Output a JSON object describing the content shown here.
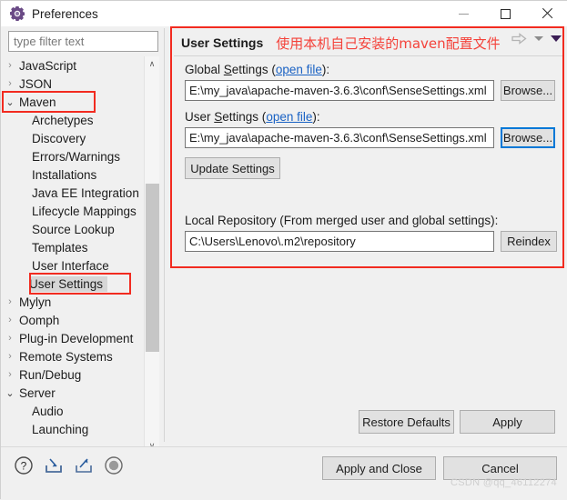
{
  "window": {
    "title": "Preferences",
    "icon": "gear-icon",
    "controls": {
      "minimize": "minimize-icon",
      "maximize": "maximize-icon",
      "close": "close-icon"
    }
  },
  "sidebar": {
    "filter": {
      "value": "",
      "placeholder": "type filter text"
    },
    "items": [
      {
        "label": "JavaScript",
        "level": 1,
        "arrow": "collapsed",
        "selected": false,
        "highlighted": false
      },
      {
        "label": "JSON",
        "level": 1,
        "arrow": "collapsed",
        "selected": false,
        "highlighted": false
      },
      {
        "label": "Maven",
        "level": 1,
        "arrow": "expanded",
        "selected": false,
        "highlighted": true
      },
      {
        "label": "Archetypes",
        "level": 2,
        "arrow": "none",
        "selected": false,
        "highlighted": false
      },
      {
        "label": "Discovery",
        "level": 2,
        "arrow": "none",
        "selected": false,
        "highlighted": false
      },
      {
        "label": "Errors/Warnings",
        "level": 2,
        "arrow": "none",
        "selected": false,
        "highlighted": false
      },
      {
        "label": "Installations",
        "level": 2,
        "arrow": "none",
        "selected": false,
        "highlighted": false
      },
      {
        "label": "Java EE Integration",
        "level": 2,
        "arrow": "none",
        "selected": false,
        "highlighted": false
      },
      {
        "label": "Lifecycle Mappings",
        "level": 2,
        "arrow": "none",
        "selected": false,
        "highlighted": false
      },
      {
        "label": "Source Lookup",
        "level": 2,
        "arrow": "none",
        "selected": false,
        "highlighted": false
      },
      {
        "label": "Templates",
        "level": 2,
        "arrow": "none",
        "selected": false,
        "highlighted": false
      },
      {
        "label": "User Interface",
        "level": 2,
        "arrow": "none",
        "selected": false,
        "highlighted": false
      },
      {
        "label": "User Settings",
        "level": 2,
        "arrow": "none",
        "selected": true,
        "highlighted": true
      },
      {
        "label": "Mylyn",
        "level": 1,
        "arrow": "collapsed",
        "selected": false,
        "highlighted": false
      },
      {
        "label": "Oomph",
        "level": 1,
        "arrow": "collapsed",
        "selected": false,
        "highlighted": false
      },
      {
        "label": "Plug-in Development",
        "level": 1,
        "arrow": "collapsed",
        "selected": false,
        "highlighted": false
      },
      {
        "label": "Remote Systems",
        "level": 1,
        "arrow": "collapsed",
        "selected": false,
        "highlighted": false
      },
      {
        "label": "Run/Debug",
        "level": 1,
        "arrow": "collapsed",
        "selected": false,
        "highlighted": false
      },
      {
        "label": "Server",
        "level": 1,
        "arrow": "expanded",
        "selected": false,
        "highlighted": false
      },
      {
        "label": "Audio",
        "level": 2,
        "arrow": "none",
        "selected": false,
        "highlighted": false
      },
      {
        "label": "Launching",
        "level": 2,
        "arrow": "none",
        "selected": false,
        "highlighted": false
      }
    ],
    "arrow_glyphs": {
      "collapsed": "›",
      "expanded": "⌄",
      "none": ""
    },
    "scrollbar": {
      "up": "∧",
      "down": "∨",
      "left": "‹",
      "right": "›"
    }
  },
  "panel": {
    "title": "User Settings",
    "annotation": "使用本机自己安装的maven配置文件",
    "annotation_color": "#f4423a",
    "tools": {
      "forward": "forward-arrow-icon",
      "menu": "chevron-down-icon",
      "view_menu": "view-menu-icon"
    },
    "global_settings": {
      "label_prefix": "Global ",
      "label_underlined": "S",
      "label_rest": "ettings (",
      "link": "open file",
      "label_suffix": "):",
      "value": "E:\\my_java\\apache-maven-3.6.3\\conf\\SenseSettings.xml",
      "browse_label": "Browse..."
    },
    "user_settings": {
      "label_prefix": "User ",
      "label_underlined": "S",
      "label_rest": "ettings (",
      "link": "open file",
      "label_suffix": "):",
      "value": "E:\\my_java\\apache-maven-3.6.3\\conf\\SenseSettings.xml",
      "browse_label": "Browse..."
    },
    "update_settings_label": "Update Settings",
    "local_repository": {
      "label": "Local Repository (From merged user and global settings):",
      "value": "C:\\Users\\Lenovo\\.m2\\repository",
      "reindex_label": "Reindex"
    },
    "restore_defaults_label": "Restore Defaults",
    "apply_label": "Apply"
  },
  "footer": {
    "icons": [
      {
        "name": "help-icon"
      },
      {
        "name": "import-icon"
      },
      {
        "name": "export-icon"
      },
      {
        "name": "record-icon"
      }
    ],
    "apply_and_close_label": "Apply and Close",
    "cancel_label": "Cancel"
  },
  "watermark": "CSDN @qq_46112274",
  "colors": {
    "annotation_red": "#f22b20",
    "link_blue": "#1a62c4",
    "focus_blue": "#0078d7",
    "selection_gray": "#d6d6d6"
  }
}
